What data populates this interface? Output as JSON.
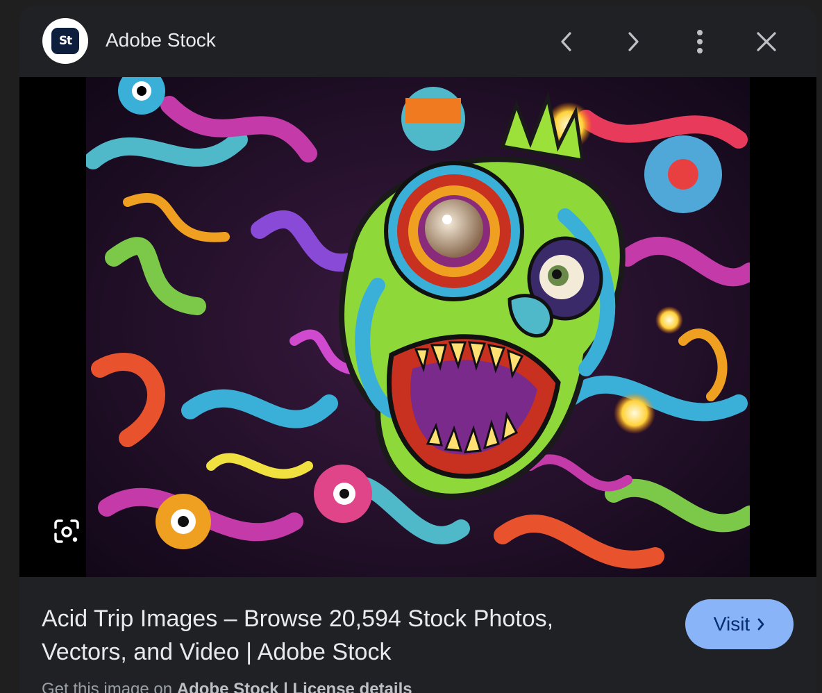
{
  "header": {
    "logo_text": "St",
    "site_name": "Adobe Stock",
    "icons": [
      "previous-icon",
      "next-icon",
      "more-vert-icon",
      "close-icon"
    ]
  },
  "viewer": {
    "lens_icon": "google-lens-icon"
  },
  "result": {
    "title": "Acid Trip Images – Browse 20,594 Stock Photos, Vectors, and Video | Adobe Stock",
    "visit_label": "Visit",
    "visit_icon": "chevron-right-icon",
    "subline_prefix": "Get this image on",
    "subline_bold": "Adobe Stock | License details"
  },
  "colors": {
    "panel_bg": "#202124",
    "accent_button": "#8ab4f8",
    "text_primary": "#e8eaed"
  }
}
